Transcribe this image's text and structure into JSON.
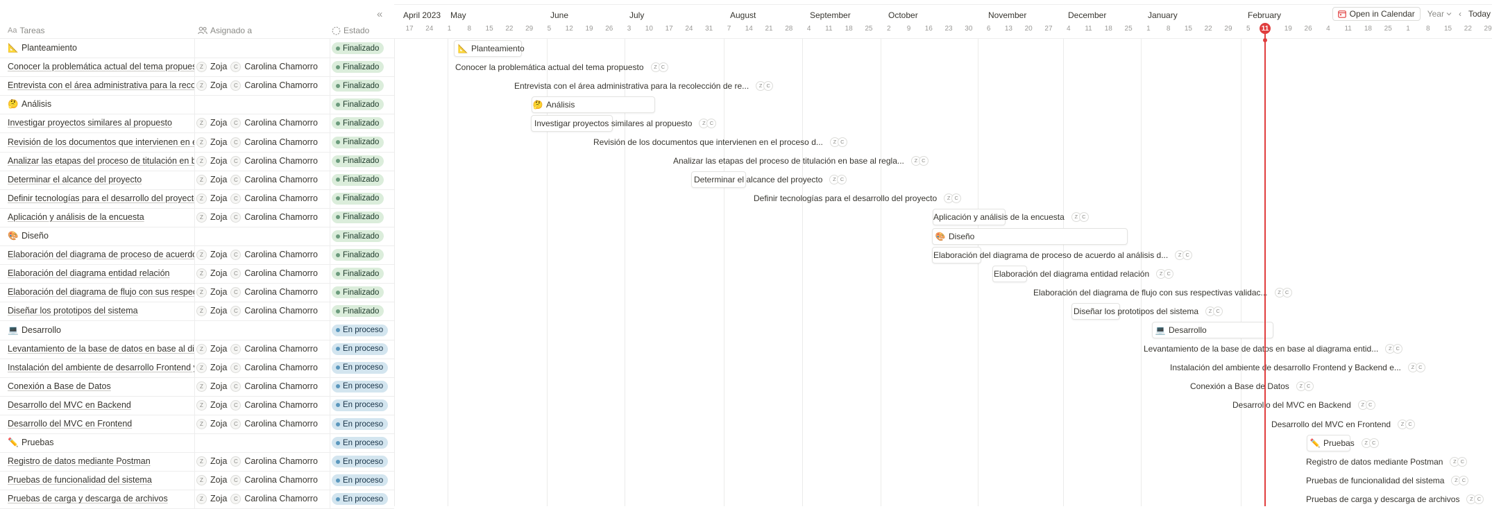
{
  "headers": {
    "task": "Tareas",
    "assigned": "Asignado a",
    "status": "Estado"
  },
  "collapse_label": "«",
  "timeline": {
    "months": [
      "April 2023",
      "May",
      "June",
      "July",
      "August",
      "September",
      "October",
      "November",
      "December",
      "January",
      "February"
    ],
    "days": [
      "17",
      "24",
      "1",
      "8",
      "15",
      "22",
      "29",
      "5",
      "12",
      "19",
      "26",
      "3",
      "10",
      "17",
      "24",
      "31",
      "7",
      "14",
      "21",
      "28",
      "4",
      "11",
      "18",
      "25",
      "2",
      "9",
      "16",
      "23",
      "30",
      "6",
      "13",
      "20",
      "27",
      "4",
      "11",
      "18",
      "25",
      "1",
      "8",
      "15",
      "22",
      "29",
      "5",
      "11",
      "19",
      "26",
      "4",
      "11",
      "18",
      "25",
      "1",
      "8",
      "15",
      "22",
      "29"
    ],
    "today": "11",
    "open_calendar": "Open in Calendar",
    "view": "Year",
    "prev": "‹",
    "today_label": "Today"
  },
  "assignees": {
    "z_initial": "Z",
    "z_name": "Zoja",
    "c_initial": "C",
    "c_name": "Carolina Chamorro"
  },
  "status_labels": {
    "done": "Finalizado",
    "progress": "En proceso"
  },
  "tasks": [
    {
      "name": "Planteamiento",
      "icon": "triangle-ruler-icon",
      "glyph": "📐",
      "group": true,
      "status": "done",
      "bar_label": "Planteamiento",
      "bar_assignees": false
    },
    {
      "name": "Conocer la problemática actual del tema propuesto",
      "status": "done",
      "bar_label": "Conocer la problemática actual del tema propuesto"
    },
    {
      "name": "Entrevista con el área administrativa para la recolección de re",
      "status": "done",
      "bar_label": "Entrevista con el área administrativa para la recolección de re..."
    },
    {
      "name": "Análisis",
      "icon": "thinking-face-icon",
      "glyph": "🤔",
      "group": true,
      "status": "done",
      "bar_label": "Análisis",
      "bar_assignees": false
    },
    {
      "name": "Investigar proyectos similares al propuesto",
      "status": "done",
      "bar_label": "Investigar proyectos similares al propuesto"
    },
    {
      "name": "Revisión de los documentos que intervienen en el proceso d",
      "status": "done",
      "bar_label": "Revisión de los documentos que intervienen en el proceso d..."
    },
    {
      "name": "Analizar las etapas del proceso de titulación en base al regla",
      "status": "done",
      "bar_label": "Analizar las etapas del proceso de titulación en base al regla..."
    },
    {
      "name": "Determinar el alcance del proyecto",
      "status": "done",
      "bar_label": "Determinar el alcance del proyecto"
    },
    {
      "name": "Definir tecnologías para el desarrollo del proyecto",
      "status": "done",
      "bar_label": "Definir tecnologías para el desarrollo del proyecto"
    },
    {
      "name": "Aplicación y análisis de la encuesta",
      "status": "done",
      "bar_label": "Aplicación y análisis de la encuesta"
    },
    {
      "name": "Diseño",
      "icon": "artist-palette-icon",
      "glyph": "🎨",
      "group": true,
      "status": "done",
      "bar_label": "Diseño",
      "bar_assignees": false
    },
    {
      "name": "Elaboración del diagrama de proceso de acuerdo al análisis d",
      "status": "done",
      "bar_label": "Elaboración del diagrama de proceso de acuerdo al análisis d..."
    },
    {
      "name": "Elaboración del diagrama entidad relación",
      "status": "done",
      "bar_label": "Elaboración del diagrama entidad relación"
    },
    {
      "name": "Elaboración del diagrama de flujo con sus respectivas validac",
      "status": "done",
      "bar_label": "Elaboración del diagrama de flujo con sus respectivas validac..."
    },
    {
      "name": "Diseñar los prototipos del sistema",
      "status": "done",
      "bar_label": "Diseñar los prototipos del sistema"
    },
    {
      "name": "Desarrollo",
      "icon": "laptop-icon",
      "glyph": "💻",
      "group": true,
      "status": "progress",
      "bar_label": "Desarrollo",
      "bar_assignees": false
    },
    {
      "name": "Levantamiento de la base de datos en base al diagrama entid",
      "status": "progress",
      "bar_label": "Levantamiento de la base de datos en base al diagrama entid..."
    },
    {
      "name": "Instalación del ambiente de desarrollo Frontend y Backend e",
      "status": "progress",
      "bar_label": "Instalación del ambiente de desarrollo Frontend y Backend e..."
    },
    {
      "name": "Conexión a Base de Datos",
      "status": "progress",
      "bar_label": "Conexión a Base de Datos"
    },
    {
      "name": "Desarrollo del MVC en Backend",
      "status": "progress",
      "bar_label": "Desarrollo del MVC en Backend"
    },
    {
      "name": "Desarrollo del MVC en Frontend",
      "status": "progress",
      "bar_label": "Desarrollo del MVC en Frontend"
    },
    {
      "name": "Pruebas",
      "icon": "pencil-icon",
      "glyph": "✏️",
      "group": true,
      "status": "progress",
      "bar_label": "Pruebas",
      "bar_assignees": true
    },
    {
      "name": "Registro de datos mediante Postman",
      "status": "progress",
      "bar_label": "Registro de datos mediante Postman"
    },
    {
      "name": "Pruebas de funcionalidad del sistema",
      "status": "progress",
      "bar_label": "Pruebas de funcionalidad del sistema"
    },
    {
      "name": "Pruebas de carga y descarga de archivos",
      "status": "progress",
      "bar_label": "Pruebas de carga y descarga de archivos"
    }
  ]
}
